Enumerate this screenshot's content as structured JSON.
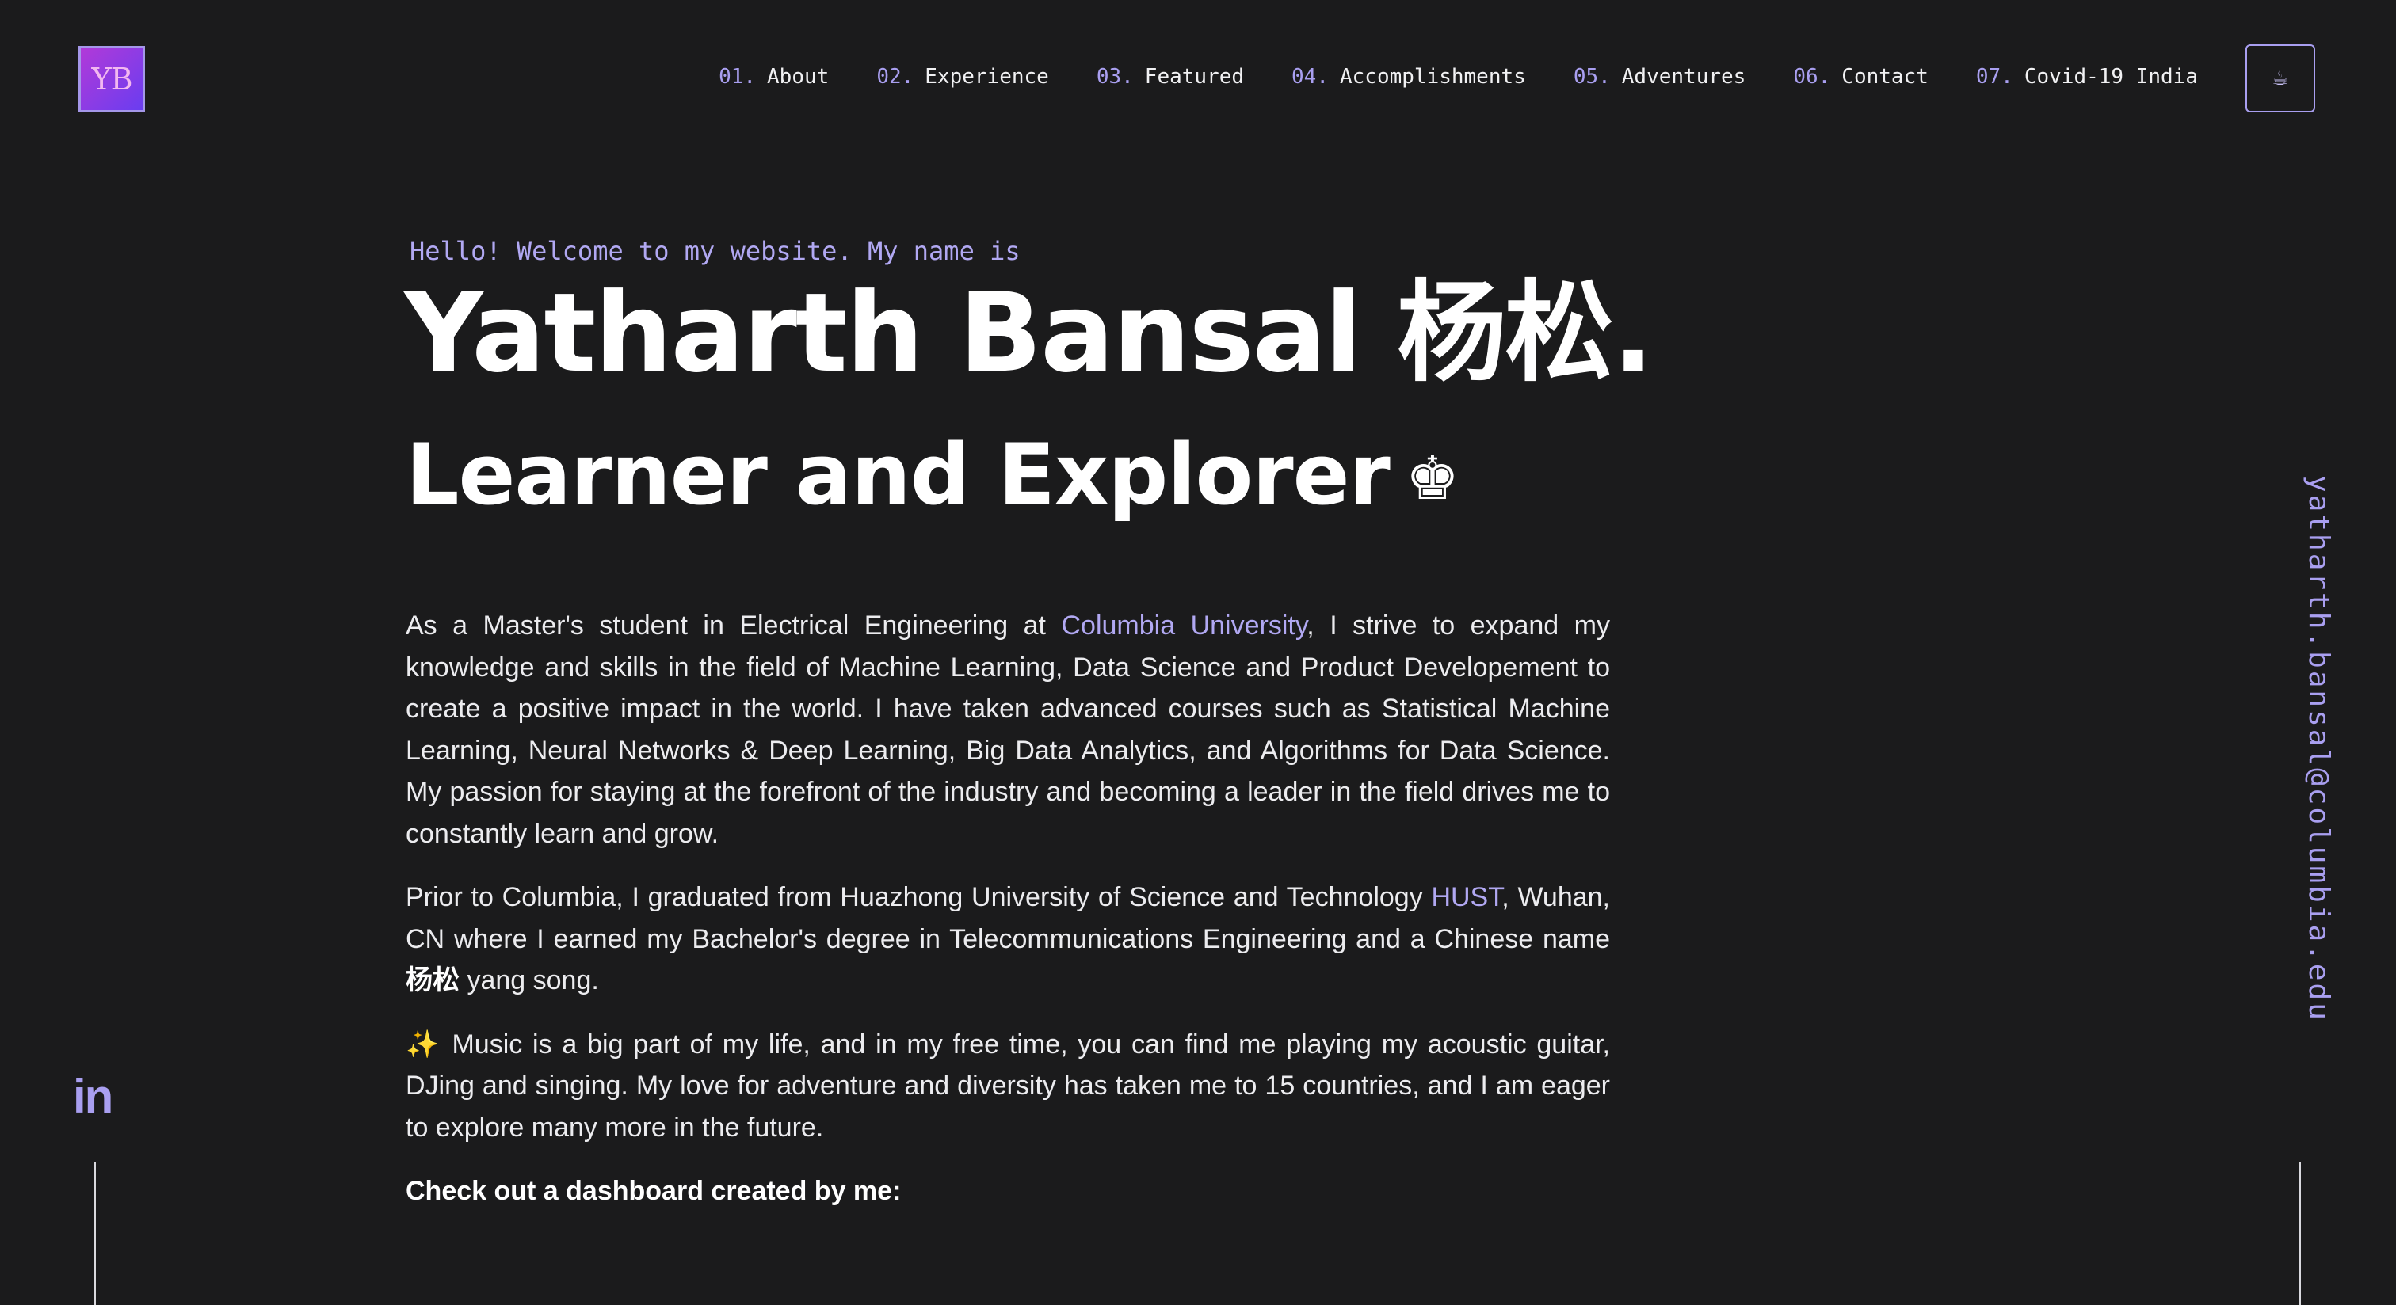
{
  "logo": {
    "text": "YB"
  },
  "nav": {
    "items": [
      {
        "num": "01.",
        "label": "About"
      },
      {
        "num": "02.",
        "label": "Experience"
      },
      {
        "num": "03.",
        "label": "Featured"
      },
      {
        "num": "04.",
        "label": "Accomplishments"
      },
      {
        "num": "05.",
        "label": "Adventures"
      },
      {
        "num": "06.",
        "label": "Contact"
      },
      {
        "num": "07.",
        "label": "Covid-19 India"
      }
    ],
    "resume_icon": "☕"
  },
  "hero": {
    "greeting": "Hello! Welcome to my website. My name is",
    "name": "Yatharth Bansal 杨松.",
    "tagline": "Learner and Explorer",
    "tagline_icon": "♚"
  },
  "bio": {
    "p1_a": "As a Master's student in Electrical Engineering at ",
    "p1_link": "Columbia University",
    "p1_b": ", I strive to expand my knowledge and skills in the field of Machine Learning, Data Science and Product Developement to create a positive impact in the world. I have taken advanced courses such as Statistical Machine Learning, Neural Networks & Deep Learning, Big Data Analytics, and Algorithms for Data Science. My passion for staying at the forefront of the industry and becoming a leader in the field drives me to constantly learn and grow.",
    "p2_a": "Prior to Columbia, I graduated from Huazhong University of Science and Technology ",
    "p2_link": "HUST",
    "p2_b": ", Wuhan, CN where I earned my Bachelor's degree in Telecommunications Engineering and a Chinese name ",
    "p2_cn": "杨松",
    "p2_c": " yang song.",
    "p3_icon": "✨",
    "p3": " Music is a big part of my life, and in my free time, you can find me playing my acoustic guitar, DJing and singing. My love for adventure and diversity has taken me to 15 countries, and I am eager to explore many more in the future.",
    "cta": "Check out a dashboard created by me:"
  },
  "social": {
    "linkedin": "in"
  },
  "email": "yatharth.bansal@columbia.edu",
  "colors": {
    "background": "#1b1b1c",
    "accent": "#a99ff0",
    "text": "#ececef"
  }
}
